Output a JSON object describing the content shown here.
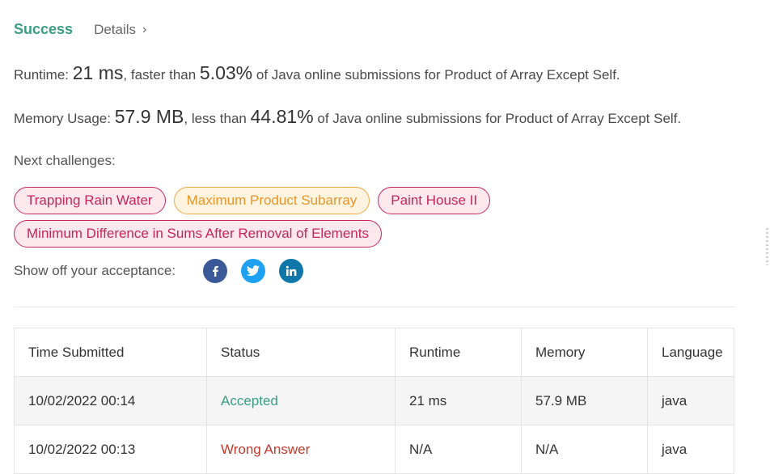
{
  "header": {
    "status": "Success",
    "details_label": "Details",
    "details_chevron": "›"
  },
  "runtime": {
    "label": "Runtime:",
    "value": "21 ms",
    "comparison": ", faster than",
    "percent": "5.03%",
    "suffix": "of Java online submissions for Product of Array Except Self."
  },
  "memory": {
    "label": "Memory Usage:",
    "value": "57.9 MB",
    "comparison": ", less than",
    "percent": "44.81%",
    "suffix": "of Java online submissions for Product of Array Except Self."
  },
  "next_challenges": {
    "label": "Next challenges:",
    "items": [
      {
        "label": "Trapping Rain Water",
        "difficulty": "hard"
      },
      {
        "label": "Maximum Product Subarray",
        "difficulty": "medium"
      },
      {
        "label": "Paint House II",
        "difficulty": "hard"
      },
      {
        "label": "Minimum Difference in Sums After Removal of Elements",
        "difficulty": "hard"
      }
    ]
  },
  "share": {
    "label": "Show off your acceptance:",
    "icons": [
      "facebook-icon",
      "twitter-icon",
      "linkedin-icon"
    ],
    "colors": {
      "facebook": "#3b5998",
      "twitter": "#1da1f2",
      "linkedin": "#0e76a8"
    }
  },
  "submissions": {
    "columns": [
      "Time Submitted",
      "Status",
      "Runtime",
      "Memory",
      "Language"
    ],
    "rows": [
      {
        "time": "10/02/2022 00:14",
        "status": "Accepted",
        "runtime": "21 ms",
        "memory": "57.9 MB",
        "language": "java"
      },
      {
        "time": "10/02/2022 00:13",
        "status": "Wrong Answer",
        "runtime": "N/A",
        "memory": "N/A",
        "language": "java"
      }
    ]
  },
  "colors": {
    "accent": "#3a9d84",
    "hard": "#c4265c",
    "medium": "#e6962a",
    "error": "#c0392b"
  }
}
